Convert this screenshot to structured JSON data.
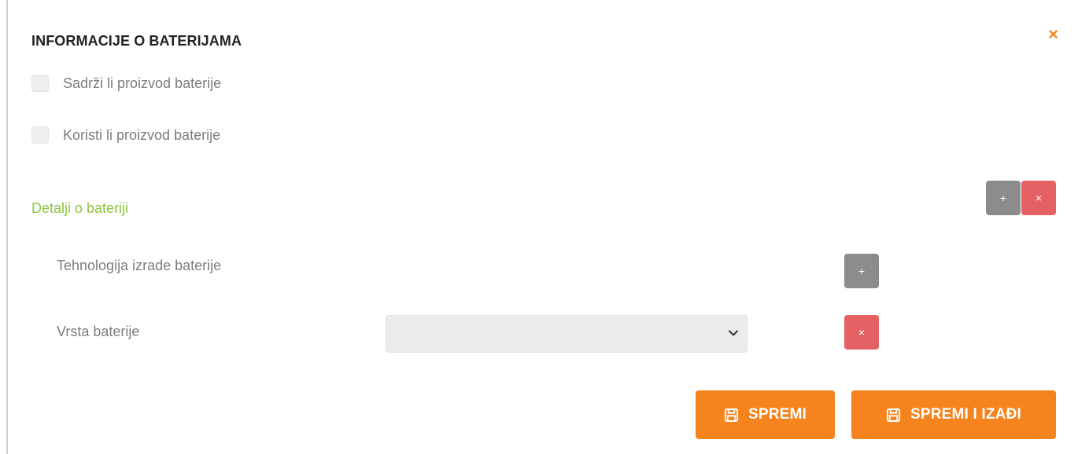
{
  "modal": {
    "title": "INFORMACIJE O BATERIJAMA",
    "close_symbol": "×",
    "accent_color": "#f5841f"
  },
  "checkboxes": [
    {
      "label": "Sadrži li proizvod baterije",
      "checked": false
    },
    {
      "label": "Koristi li proizvod baterije",
      "checked": false
    }
  ],
  "details_section": {
    "title": "Detalji o bateriji",
    "title_color": "#8cc63f",
    "add_symbol": "+",
    "remove_symbol": "×"
  },
  "fields": {
    "technology": {
      "label": "Tehnologija izrade baterije",
      "add_symbol": "+"
    },
    "type": {
      "label": "Vrsta baterije",
      "selected_value": "",
      "remove_symbol": "×"
    }
  },
  "actions": {
    "save_label": "SPREMI",
    "save_exit_label": "SPREMI I IZAĐI",
    "icon": "floppy-disk-icon"
  }
}
